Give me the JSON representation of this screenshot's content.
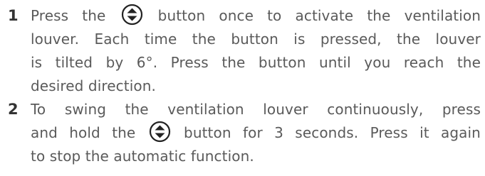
{
  "steps": [
    {
      "number": "1",
      "lines": [
        {
          "before": "Press the",
          "icon": "up-down-arrow-button-icon",
          "after": "button once to activate the ventilation"
        },
        {
          "text": "louver. Each time the button is pressed, the louver"
        },
        {
          "text": "is tilted by 6°. Press the button until you reach the"
        },
        {
          "text": "desired direction."
        }
      ]
    },
    {
      "number": "2",
      "lines": [
        {
          "text": "To swing the ventilation louver continuously, press"
        },
        {
          "before": "and hold the",
          "icon": "up-down-arrow-button-icon",
          "after": "button for 3 seconds. Press it again"
        },
        {
          "text": "to stop the automatic function."
        }
      ]
    }
  ],
  "colors": {
    "body_text": "#5a5a5a",
    "number_text": "#333333",
    "icon_stroke": "#222222"
  }
}
